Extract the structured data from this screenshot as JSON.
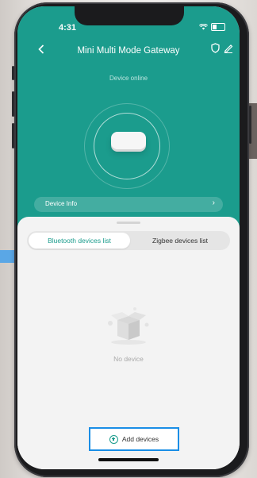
{
  "status": {
    "time": "4:31"
  },
  "header": {
    "title": "Mini Multi Mode Gateway",
    "back_icon": "chevron-left-icon",
    "shield_icon": "shield-icon",
    "edit_icon": "edit-icon"
  },
  "device": {
    "status": "Device online"
  },
  "info_bar": {
    "label": "Device Info",
    "arrow": "›"
  },
  "tabs": [
    {
      "label": "Bluetooth devices list",
      "active": true
    },
    {
      "label": "Zigbee devices list",
      "active": false
    }
  ],
  "empty": {
    "text": "No device"
  },
  "actions": {
    "add_label": "Add devices"
  },
  "colors": {
    "accent": "#1b9c8d",
    "highlight": "#1a8ee6"
  }
}
